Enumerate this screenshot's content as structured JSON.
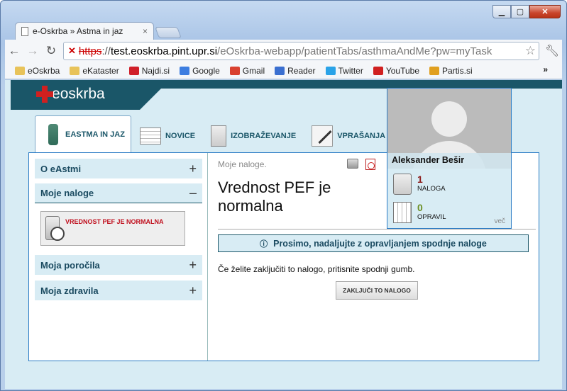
{
  "browser": {
    "tab_title": "e-Oskrba » Astma in jaz",
    "tab_close": "×",
    "url_protocol": "https",
    "url_sep": "://",
    "url_host": "test.eoskrba.pint.upr.si",
    "url_path": "/eOskrba-webapp/patientTabs/asthmaAndMe?pw=myTask",
    "bookmarks": [
      {
        "label": "eOskrba",
        "icon": "folder-icon",
        "color": "#e8c35a"
      },
      {
        "label": "eKataster",
        "icon": "folder-icon",
        "color": "#e8c35a"
      },
      {
        "label": "Najdi.si",
        "icon": "najdi-icon",
        "color": "#d0202a"
      },
      {
        "label": "Google",
        "icon": "google-icon",
        "color": "#3c7de0"
      },
      {
        "label": "Gmail",
        "icon": "gmail-icon",
        "color": "#d9412f"
      },
      {
        "label": "Reader",
        "icon": "reader-icon",
        "color": "#3a6fd0"
      },
      {
        "label": "Twitter",
        "icon": "twitter-icon",
        "color": "#2aa3e8"
      },
      {
        "label": "YouTube",
        "icon": "youtube-icon",
        "color": "#d02020"
      },
      {
        "label": "Partis.si",
        "icon": "partis-icon",
        "color": "#e0a020"
      }
    ],
    "bookmarks_more": "»"
  },
  "site": {
    "logo_text": "oskrba",
    "logo_prefix": "e",
    "tabs": [
      {
        "label": "eAstma in jaz",
        "icon": "inhaler-icon",
        "active": true
      },
      {
        "label": "Novice",
        "icon": "newspaper-icon",
        "active": false
      },
      {
        "label": "Izobraževanje",
        "icon": "education-icon",
        "active": false
      },
      {
        "label": "Vprašanja",
        "icon": "questions-icon",
        "active": false
      }
    ]
  },
  "sidebar": {
    "sections": [
      {
        "label": "O eAstmi",
        "sign": "+"
      },
      {
        "label": "Moje naloge",
        "sign": "–"
      },
      {
        "label": "Moja poročila",
        "sign": "+"
      },
      {
        "label": "Moja zdravila",
        "sign": "+"
      }
    ],
    "task_label": "VREDNOST PEF JE NORMALNA"
  },
  "main": {
    "breadcrumb": "Moje naloge.",
    "title": "Vrednost PEF je normalna",
    "notice": "Prosimo, nadaljujte z opravljanjem spodnje naloge",
    "instruction": "Če želite zaključiti to nalogo, pritisnite spodnji gumb.",
    "finish_button": "ZAKLJUČI TO NALOGO"
  },
  "user": {
    "name": "Aleksander Bešir",
    "tasks_count": "1",
    "tasks_label": "NALOGA",
    "tasks_color": "#8b1a1a",
    "done_count": "0",
    "done_label": "OPRAVIL",
    "done_color": "#6b8e23",
    "more": "več"
  },
  "colors": {
    "brand": "#1a5668",
    "accent_blue": "#2b7cc5",
    "panel_bg": "#d8ecf4",
    "alert_red": "#c0101e"
  }
}
